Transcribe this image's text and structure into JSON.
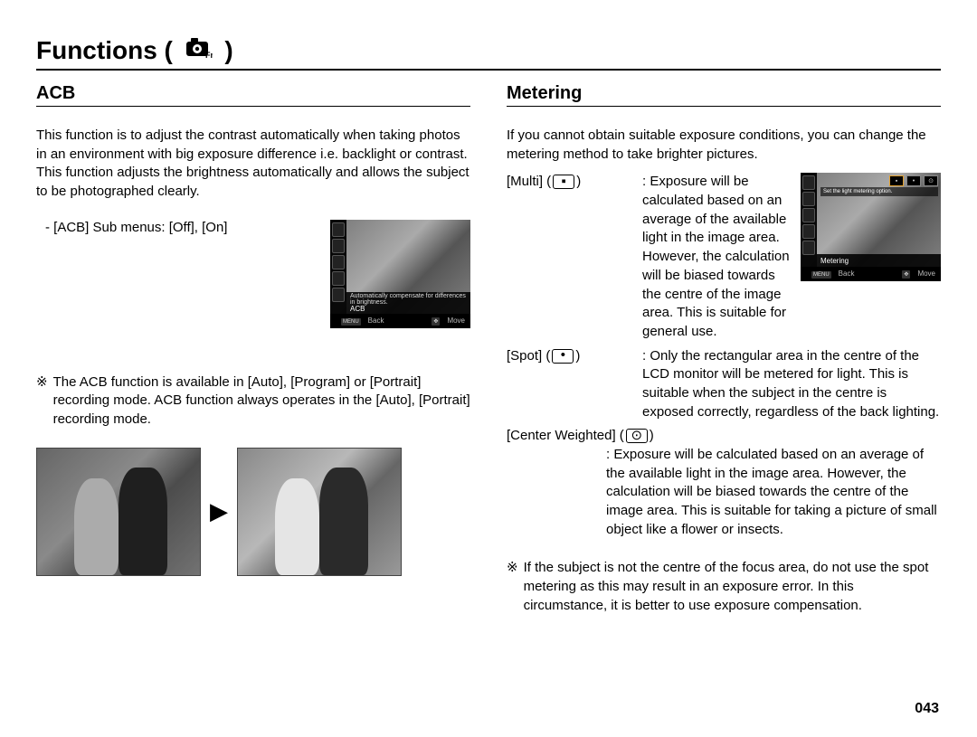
{
  "header": {
    "title": "Functions",
    "icon": "camera-fn-icon"
  },
  "page_number": "043",
  "left": {
    "heading": "ACB",
    "intro": "This function is to adjust the contrast automatically when taking photos in an environment with big exposure difference i.e. backlight or contrast. This function adjusts the brightness automatically and allows the subject to be photographed clearly.",
    "submenus": "- [ACB] Sub menus: [Off], [On]",
    "lcd": {
      "hint": "Automatically compensate for differences in brightness.",
      "mode": "ACB",
      "foot_back_btn": "MENU",
      "foot_back": "Back",
      "foot_move_btn": "✥",
      "foot_move": "Move"
    },
    "note_mark": "※",
    "note": "The ACB function is available in [Auto], [Program] or [Portrait] recording mode. ACB function always operates in the [Auto], [Portrait] recording mode.",
    "arrow": "▶"
  },
  "right": {
    "heading": "Metering",
    "intro": "If you cannot obtain suitable exposure conditions, you can change the metering method to take brighter pictures.",
    "lcd": {
      "tip": "Set the light metering option.",
      "mode": "Metering",
      "foot_back_btn": "MENU",
      "foot_back": "Back",
      "foot_move_btn": "✥",
      "foot_move": "Move"
    },
    "items": [
      {
        "label": "[Multi]",
        "icon_symbol": "▪",
        "desc_prefix": ": ",
        "desc": "Exposure will be calculated based on an average of the available light in the image area. However, the calculation will be biased towards the centre of the image area. This is suitable for general use."
      },
      {
        "label": "[Spot]",
        "icon_symbol": "•",
        "desc_prefix": ": ",
        "desc": "Only the rectangular area in the centre of the LCD monitor will be metered for light. This is suitable when the subject in the centre is exposed correctly, regardless of the back lighting."
      },
      {
        "label": "[Center Weighted]",
        "icon_symbol": "⊙",
        "desc_prefix": ": ",
        "desc": "Exposure will be calculated based on an average of the available light in the image area. However, the calculation will be biased towards the centre of the image area. This is suitable for taking a picture of small object like a flower or insects."
      }
    ],
    "note_mark": "※",
    "note": "If the subject is not the centre of the focus area, do not use the spot metering as this may result in an exposure error. In this circumstance, it is better to use exposure compensation."
  }
}
